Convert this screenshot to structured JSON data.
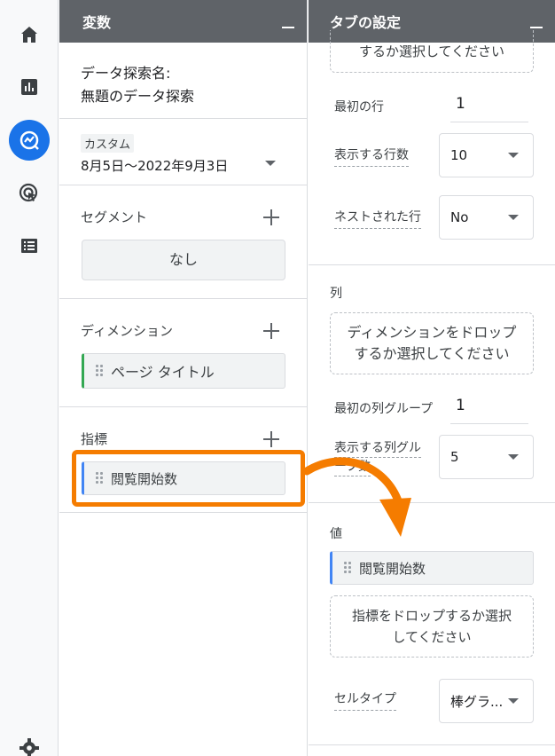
{
  "nav": {
    "items": [
      {
        "icon": "home-icon"
      },
      {
        "icon": "reports-icon"
      },
      {
        "icon": "explore-icon"
      },
      {
        "icon": "advertising-icon"
      },
      {
        "icon": "configure-icon"
      },
      {
        "icon": "settings-icon"
      }
    ]
  },
  "variables": {
    "header": "変数",
    "exploration_name_label": "データ探索名:",
    "exploration_name": "無題のデータ探索",
    "date_badge": "カスタム",
    "date_range": "8月5日〜2022年9月3日",
    "segment_label": "セグメント",
    "segment_value": "なし",
    "dimension_label": "ディメンション",
    "dimension_chip": "ページ タイトル",
    "metric_label": "指標",
    "metric_chip": "閲覧開始数"
  },
  "tab_settings": {
    "header": "タブの設定",
    "top_dropzone": "するか選択してください",
    "first_row_label": "最初の行",
    "first_row_value": "1",
    "rows_shown_label": "表示する行数",
    "rows_shown_value": "10",
    "nested_rows_label": "ネストされた行",
    "nested_rows_value": "No",
    "columns_label": "列",
    "columns_dropzone_line1": "ディメンションをドロップ",
    "columns_dropzone_line2": "するか選択してください",
    "first_col_group_label": "最初の列グループ",
    "first_col_group_value": "1",
    "col_groups_shown_label_line1": "表示する列グル",
    "col_groups_shown_label_line2": "ープ数",
    "col_groups_shown_value": "5",
    "values_label": "値",
    "values_chip": "閲覧開始数",
    "values_dropzone_line1": "指標をドロップするか選択",
    "values_dropzone_line2": "してください",
    "cell_type_label": "セルタイプ",
    "cell_type_value": "棒グラ..."
  },
  "annotation": {
    "highlight_color": "#f57c00",
    "arrow_color": "#f57c00"
  }
}
